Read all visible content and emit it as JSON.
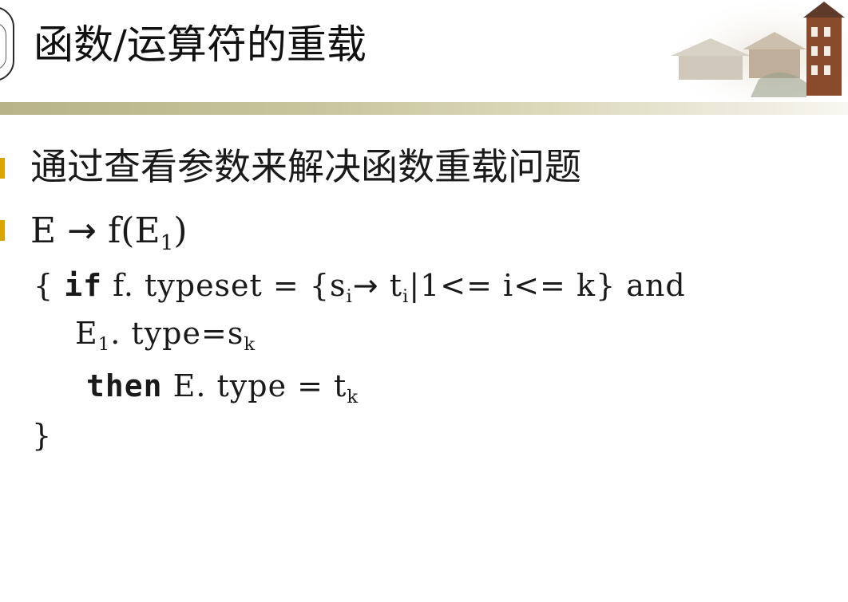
{
  "slide": {
    "title": "函数/运算符的重载"
  },
  "bullets": [
    {
      "text": "通过查看参数来解决函数重载问题"
    },
    {
      "lhs": "E",
      "arrow": "→",
      "fn": "f",
      "open": "(",
      "arg": "E",
      "arg_sub": "1",
      "close": ")"
    }
  ],
  "code": {
    "l1_open": "{",
    "kw_if": "if",
    "l1_a": "f. typeset = {s",
    "sub_i1": "i",
    "arrow": "→",
    "l1_t": "t",
    "sub_i2": "i",
    "l1_b": "|1<= i<= k} and",
    "l2_e": "E",
    "l2_sub1": "1",
    "l2_rest": ". type=s",
    "l2_subk": "k",
    "kw_then": "then",
    "l3_rest": "E. type = t",
    "l3_subk": "k",
    "l4_close": "}"
  },
  "colors": {
    "bullet": "#d9a400",
    "rule_start": "#b8b488",
    "rule_end": "#f8f7f1"
  }
}
